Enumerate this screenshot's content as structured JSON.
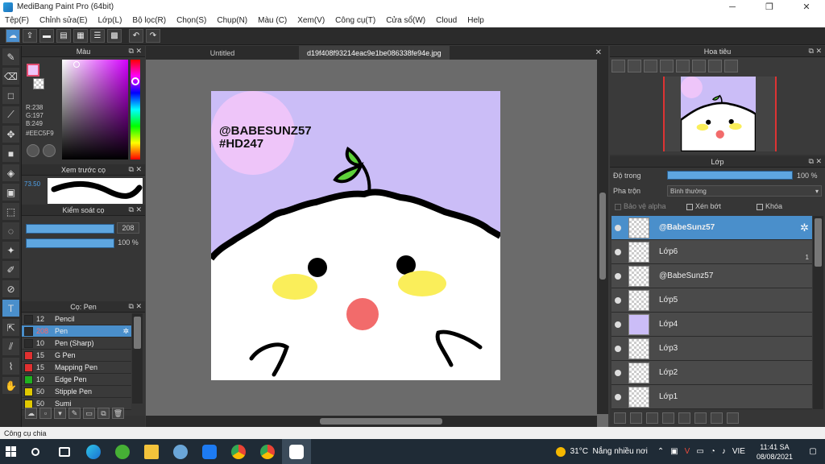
{
  "window": {
    "title": "MediBang Paint Pro (64bit)",
    "minimize": "─",
    "restore": "❐",
    "close": "✕"
  },
  "menu": [
    "Tệp(F)",
    "Chỉnh sửa(E)",
    "Lớp(L)",
    "Bộ lọc(R)",
    "Chọn(S)",
    "Chụp(N)",
    "Màu (C)",
    "Xem(V)",
    "Công cụ(T)",
    "Cửa sổ(W)",
    "Cloud",
    "Help"
  ],
  "color_panel": {
    "title": "Màu",
    "r": "R:238",
    "g": "G:197",
    "b": "B:249",
    "hex": "#EEC5F9",
    "foreground": "#EEC5F9"
  },
  "preview_panel": {
    "title": "Xem trước cọ",
    "size": "73.50"
  },
  "brush_control": {
    "title": "Kiểm soát cọ",
    "size_value": "208",
    "opacity_value": "100 %"
  },
  "brush_panel": {
    "title": "Cọ: Pen",
    "brushes": [
      {
        "size": "12",
        "name": "Pencil",
        "color": "#2b2b2b"
      },
      {
        "size": "208",
        "name": "Pen",
        "color": "#2b2b2b",
        "active": true
      },
      {
        "size": "10",
        "name": "Pen (Sharp)",
        "color": "#2b2b2b"
      },
      {
        "size": "15",
        "name": "G Pen",
        "color": "#e03030"
      },
      {
        "size": "15",
        "name": "Mapping Pen",
        "color": "#e03030"
      },
      {
        "size": "10",
        "name": "Edge Pen",
        "color": "#20b020"
      },
      {
        "size": "50",
        "name": "Stipple Pen",
        "color": "#e0c800"
      },
      {
        "size": "50",
        "name": "Sumi",
        "color": "#e0c800"
      }
    ]
  },
  "canvas": {
    "tabs": [
      "Untitled",
      "d19f408f93214eac9e1be086338fe94e.jpg"
    ],
    "tab_close": "✕",
    "watermark_line1": "@BABESUNZ57",
    "watermark_line2": "#HD247",
    "background": "#CBBDF7"
  },
  "navigator": {
    "title": "Hoa tiêu"
  },
  "layer_panel": {
    "title": "Lớp",
    "opacity_label": "Độ trong",
    "opacity_value": "100 %",
    "blend_label": "Pha trộn",
    "blend_value": "Bình thường",
    "protect_alpha": "Bảo vệ alpha",
    "clipping": "Xén bớt",
    "lock": "Khóa",
    "layers": [
      "@BabeSunz57",
      "Lớp6",
      "@BabeSunz57",
      "Lớp5",
      "Lớp4",
      "Lớp3",
      "Lớp2",
      "Lớp1"
    ],
    "lop6_mark": "1"
  },
  "status": {
    "text": "Công cụ chia"
  },
  "taskbar": {
    "temperature": "31°C",
    "weather": "Nắng nhiều nơi",
    "lang": "VIE",
    "time": "11:41 SA",
    "date": "08/08/2021"
  }
}
